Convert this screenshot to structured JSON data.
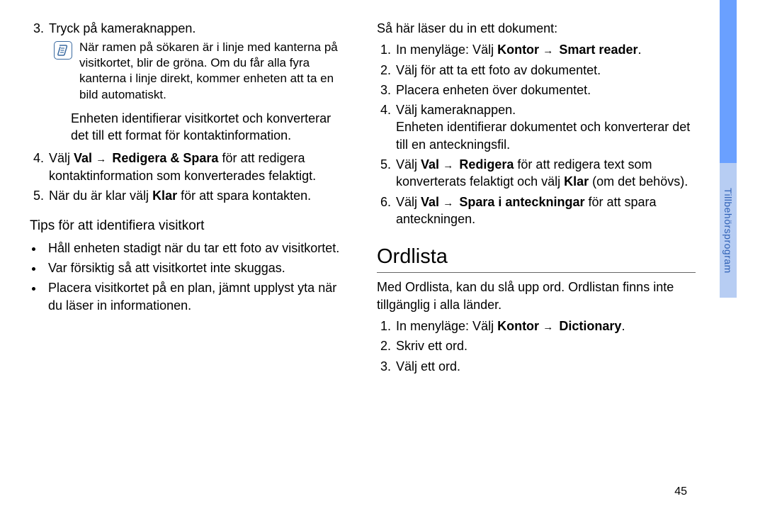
{
  "sideTab": "Tillbehörsprogram",
  "pageNumber": "45",
  "left": {
    "item3": "Tryck på kameraknappen.",
    "note": "När ramen på sökaren är i linje med kanterna på visitkortet, blir de gröna. Om du får alla fyra kanterna i linje direkt, kommer enheten att ta en bild automatiskt.",
    "afterNote": "Enheten identifierar visitkortet och konverterar det till ett format för kontaktinformation.",
    "item4_pre": "Välj ",
    "item4_b1": "Val",
    "item4_mid": " → ",
    "item4_b2": "Redigera & Spara",
    "item4_post": " för att redigera kontaktinformation som konverterades felaktigt.",
    "item5_pre": "När du är klar välj ",
    "item5_b": "Klar",
    "item5_post": " för att spara kontakten.",
    "subhead": "Tips för att identifiera visitkort",
    "tip1": "Håll enheten stadigt när du tar ett foto av visitkortet.",
    "tip2": "Var försiktig så att visitkortet inte skuggas.",
    "tip3": "Placera visitkortet på en plan, jämnt upplyst yta när du läser in informationen."
  },
  "right": {
    "intro": "Så här läser du in ett dokument:",
    "r1_pre": "In menyläge: Välj ",
    "r1_b1": "Kontor",
    "r1_b2": "Smart reader",
    "r2": "Välj     för att ta ett foto av dokumentet.",
    "r3": "Placera enheten över dokumentet.",
    "r4": "Välj kameraknappen.",
    "r4_desc": "Enheten identifierar dokumentet och konverterar det till en anteckningsfil.",
    "r5_pre": "Välj ",
    "r5_b1": "Val",
    "r5_b2": "Redigera",
    "r5_mid": " för att redigera text som konverterats felaktigt och välj ",
    "r5_b3": "Klar",
    "r5_post": " (om det behövs).",
    "r6_pre": "Välj ",
    "r6_b1": "Val",
    "r6_b2": "Spara i anteckningar",
    "r6_post": " för att spara anteckningen.",
    "sectionTitle": "Ordlista",
    "dictIntro": "Med Ordlista, kan du slå upp ord. Ordlistan finns inte tillgänglig i alla länder.",
    "d1_pre": "In menyläge: Välj ",
    "d1_b1": "Kontor",
    "d1_b2": "Dictionary",
    "d2": "Skriv ett ord.",
    "d3": "Välj ett ord."
  }
}
